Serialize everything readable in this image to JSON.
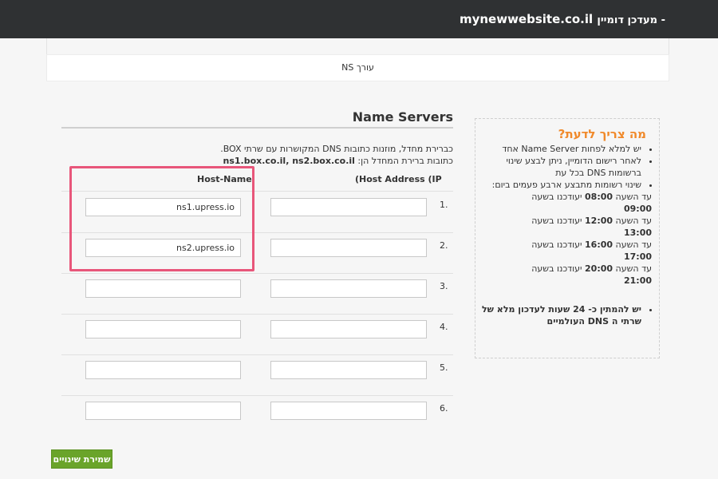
{
  "header": {
    "title_prefix": "מעדכן דומיין -",
    "domain": "mynewwebsite.co.il"
  },
  "ns_bar": {
    "label": "עורך NS"
  },
  "section": {
    "title": "Name Servers",
    "desc_line1": "כברירת מחדל, מוזנות כתובות DNS המקושרות עם שרתי BOX.",
    "desc_line2_prefix": "כתובות ברירת המחדל הן:",
    "desc_line2_values": "ns1.box.co.il, ns2.box.co.il"
  },
  "table": {
    "col_host": "Host-Name",
    "col_ip": "(Host Address (IP",
    "rows": [
      {
        "num": ".1",
        "host": "ns1.upress.io",
        "ip": ""
      },
      {
        "num": ".2",
        "host": "ns2.upress.io",
        "ip": ""
      },
      {
        "num": ".3",
        "host": "",
        "ip": ""
      },
      {
        "num": ".4",
        "host": "",
        "ip": ""
      },
      {
        "num": ".5",
        "host": "",
        "ip": ""
      },
      {
        "num": ".6",
        "host": "",
        "ip": ""
      }
    ]
  },
  "save_button": {
    "label": "שמירת שינויים"
  },
  "info_box": {
    "heading": "מה צריך לדעת?",
    "item1": "יש למלא לפחות Name Server אחד",
    "item2": "לאחר רישום הדומיין, ניתן לבצע שינוי ברשומות DNS בכל עת",
    "item3": "שינוי רשומות מתבצע ארבע פעמים ביום:",
    "times": [
      {
        "prefix": "עד השעה",
        "start": "08:00",
        "mid": "יעודכנו בשעה",
        "end": "09:00"
      },
      {
        "prefix": "עד השעה",
        "start": "12:00",
        "mid": "יעודכנו בשעה",
        "end": "13:00"
      },
      {
        "prefix": "עד השעה",
        "start": "16:00",
        "mid": "יעודכנו בשעה",
        "end": "17:00"
      },
      {
        "prefix": "עד השעה",
        "start": "20:00",
        "mid": "יעודכנו בשעה",
        "end": "21:00"
      }
    ],
    "item4": "יש להמתין כ- 24 שעות לעדכון מלא של שרתי ה DNS העולמיים"
  },
  "colors": {
    "topbar": "#2f3133",
    "heading_orange": "#f0892a",
    "save_green": "#6aa42a",
    "highlight_pink": "#e8567a"
  }
}
